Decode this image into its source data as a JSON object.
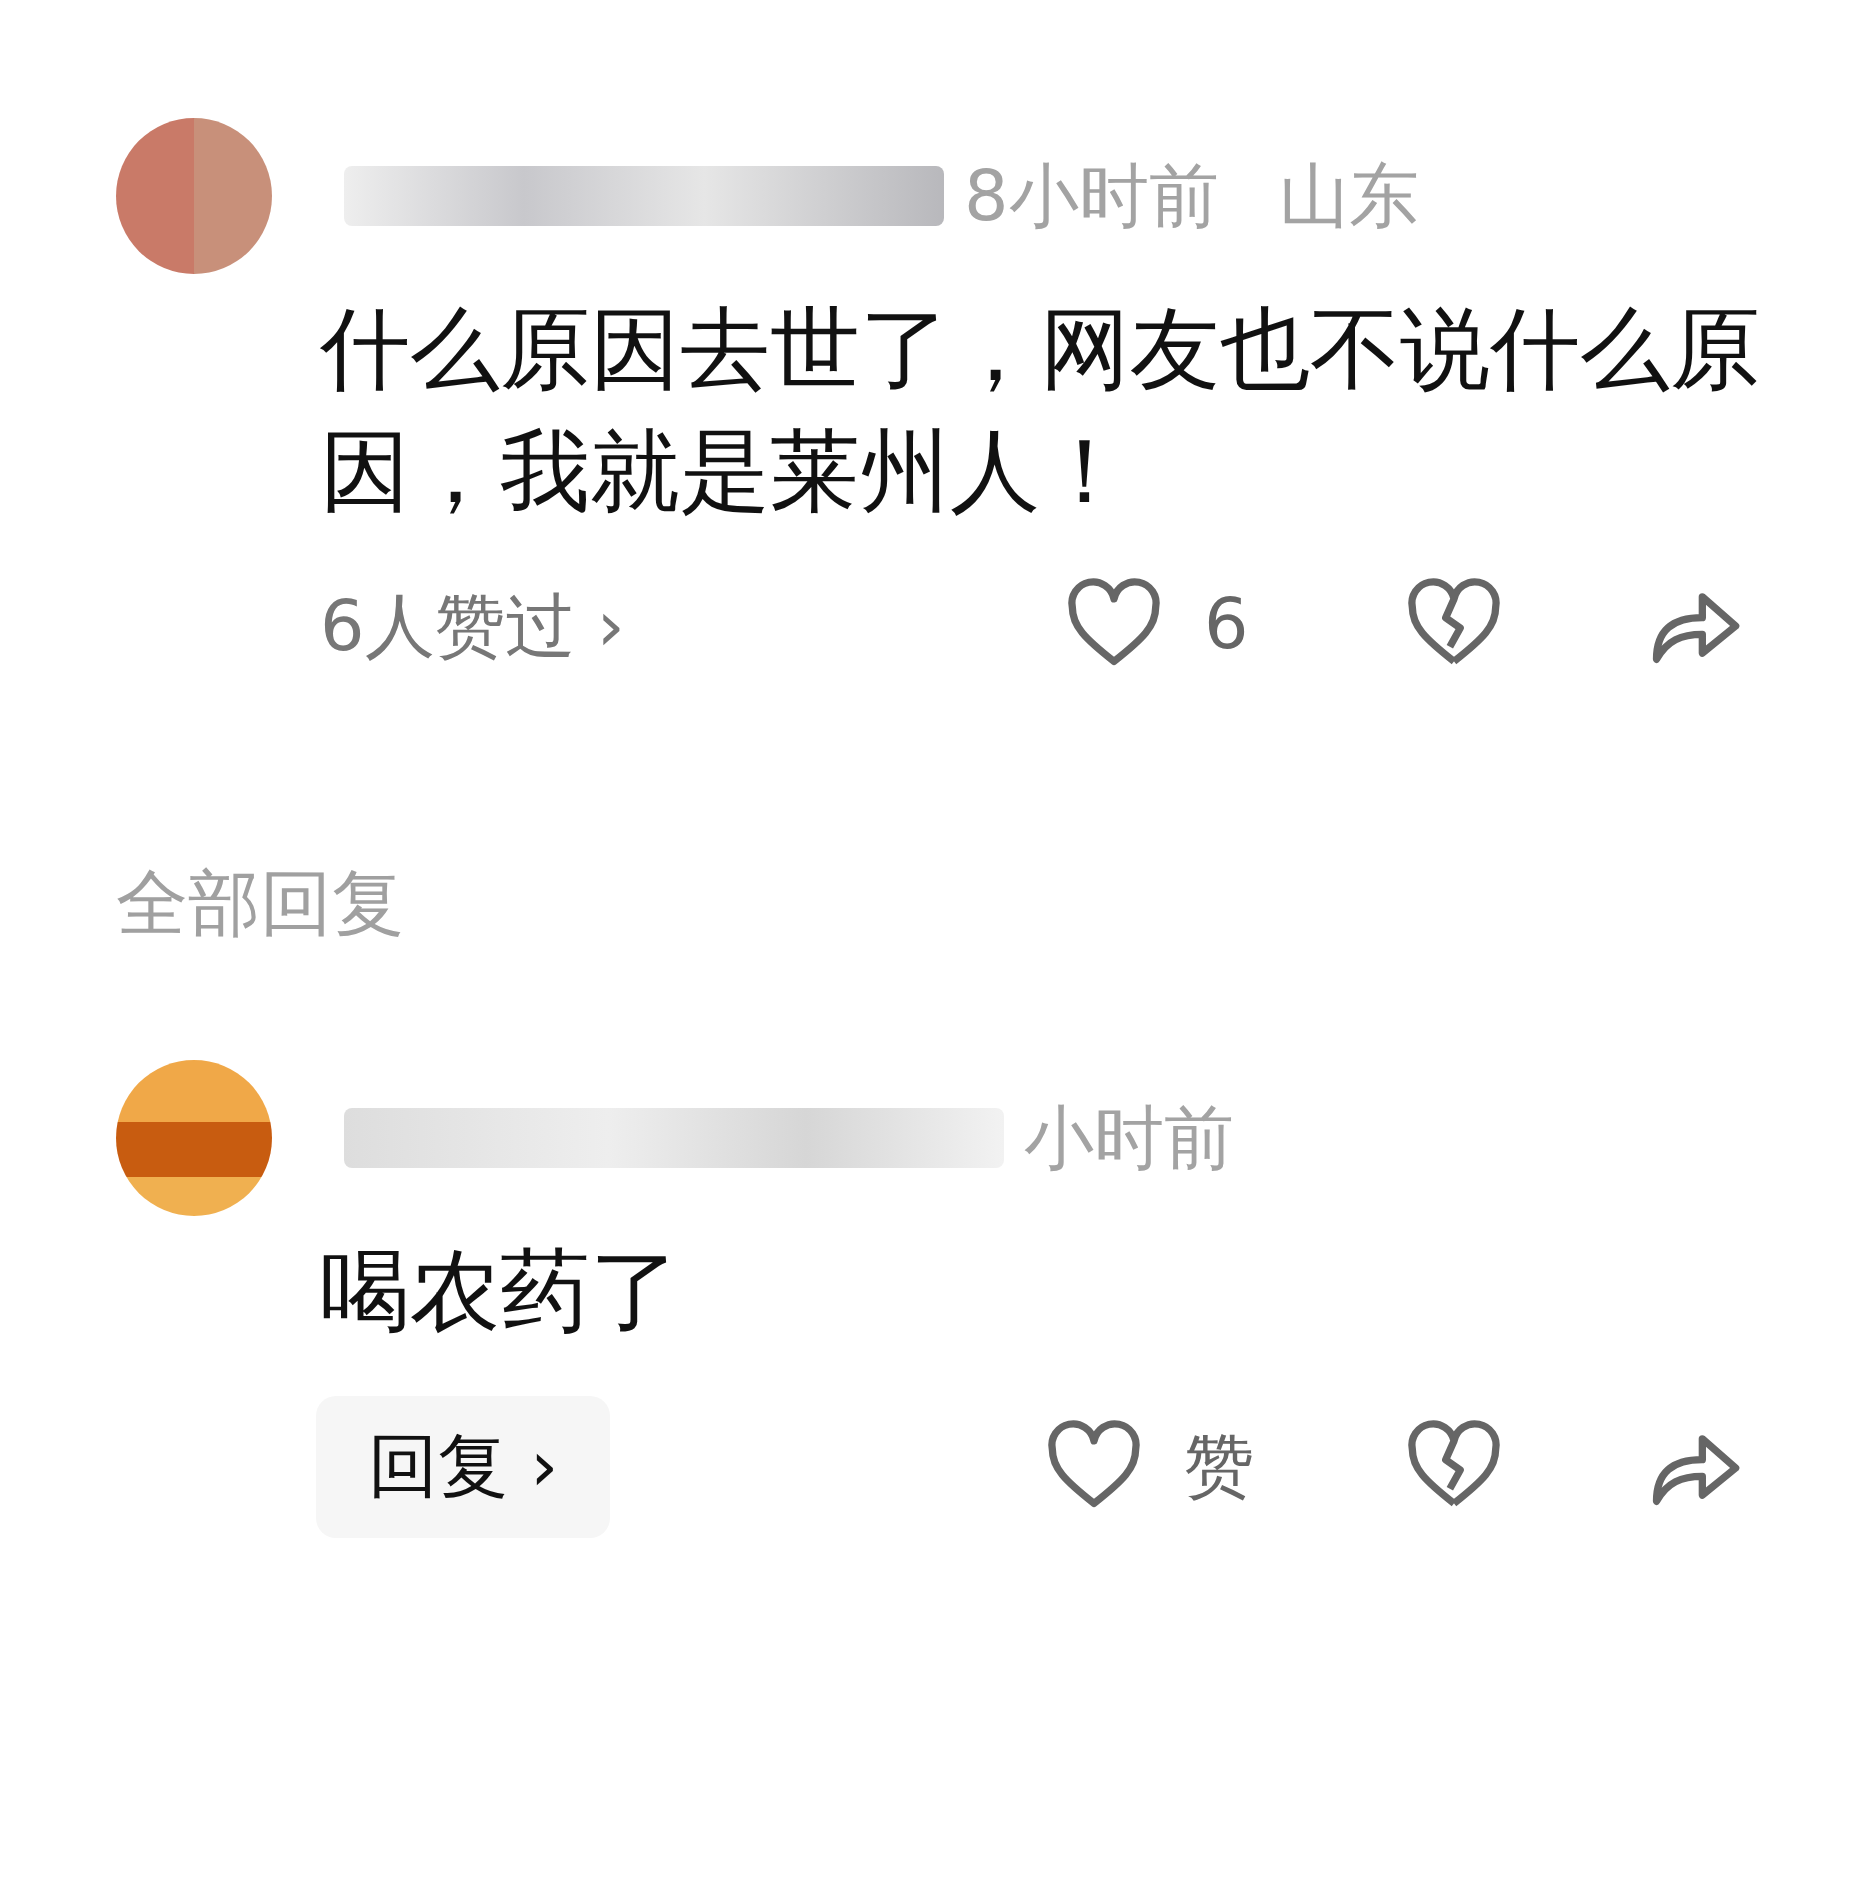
{
  "comment": {
    "time": "8小时前",
    "location": "山东",
    "text": "什么原因去世了，网友也不说什么原因，我就是莱州人！",
    "likers": "6人赞过",
    "chevron": "›",
    "like_count": "6"
  },
  "replies_heading": "全部回复",
  "replies": [
    {
      "time": "小时前",
      "text": "喝农药了",
      "reply_button": "回复",
      "chevron": "›",
      "like_label": "赞"
    }
  ]
}
